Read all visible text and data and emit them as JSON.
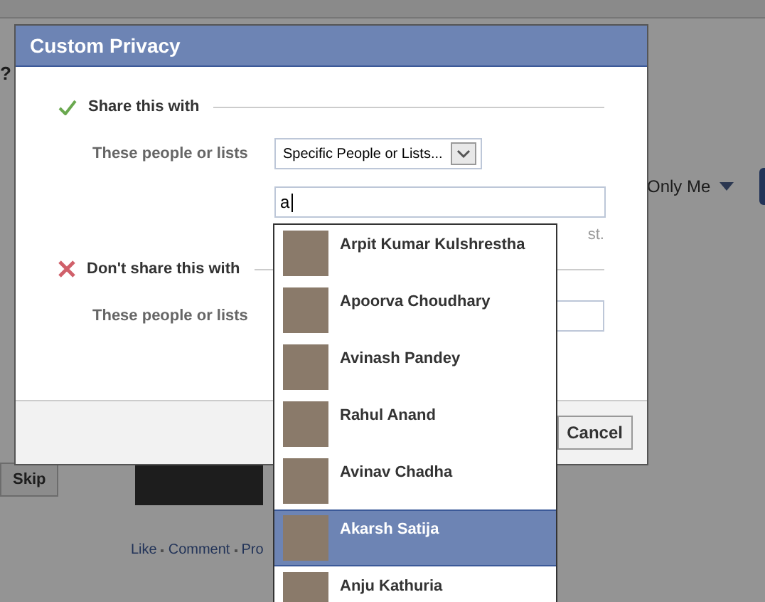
{
  "background": {
    "question_mark": "?",
    "audience_button": "Only Me",
    "skip_button": "Skip",
    "actions": [
      "Like",
      "Comment",
      "Pro"
    ]
  },
  "dialog": {
    "title": "Custom Privacy",
    "share_section": {
      "heading": "Share this with",
      "field_label": "These people or lists",
      "select_value": "Specific People or Lists...",
      "search_value": "a",
      "hint_fragment": "st."
    },
    "dont_share_section": {
      "heading": "Don't share this with",
      "field_label": "These people or lists"
    },
    "cancel_button": "Cancel"
  },
  "suggestions": [
    {
      "name": "Arpit Kumar Kulshrestha",
      "selected": false
    },
    {
      "name": "Apoorva Choudhary",
      "selected": false
    },
    {
      "name": "Avinash Pandey",
      "selected": false
    },
    {
      "name": "Rahul Anand",
      "selected": false
    },
    {
      "name": "Avinav Chadha",
      "selected": false
    },
    {
      "name": "Akarsh Satija",
      "selected": true
    },
    {
      "name": "Anju Kathuria",
      "selected": false
    }
  ]
}
